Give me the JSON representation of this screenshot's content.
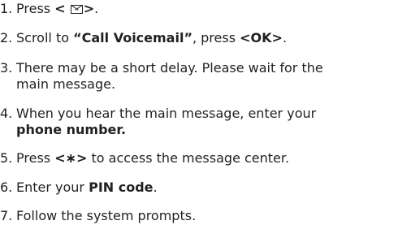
{
  "steps": [
    {
      "num": "1.",
      "pre": "Press ",
      "key_open": "<",
      "key_close": ">",
      "post": "."
    },
    {
      "num": "2.",
      "pre": "Scroll to ",
      "bold": "“Call Voicemail”",
      "mid": ", press ",
      "key": "<OK>",
      "post": "."
    },
    {
      "num": "3.",
      "line1": "There may be a short delay. Please wait for the",
      "line2": "main message."
    },
    {
      "num": "4.",
      "line1": "When you hear the main message, enter your",
      "bold": "phone number."
    },
    {
      "num": "5.",
      "pre": "Press ",
      "key": "<∗>",
      "post": " to access the message center."
    },
    {
      "num": "6.",
      "pre": "Enter your ",
      "bold": "PIN code",
      "post": "."
    },
    {
      "num": "7.",
      "text": "Follow the system prompts."
    }
  ],
  "icons": {
    "message_key": "envelope-icon"
  }
}
